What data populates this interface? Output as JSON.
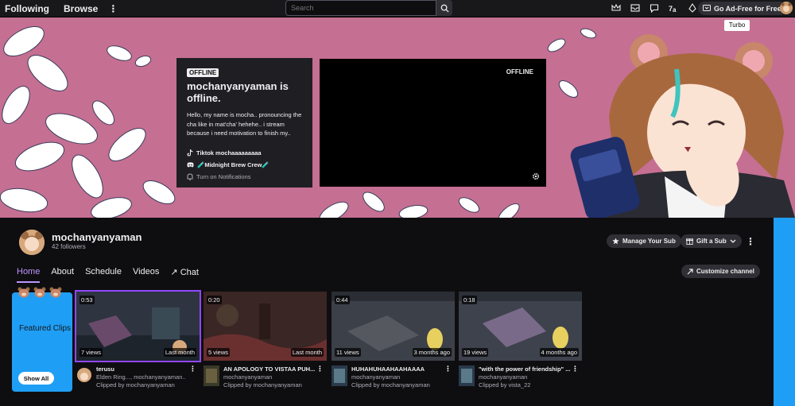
{
  "nav": {
    "following": "Following",
    "browse": "Browse",
    "more": "⋮",
    "search_placeholder": "Search",
    "ad_free": "Go Ad-Free for Free",
    "tooltip": "Turbo"
  },
  "card": {
    "offline_tag": "OFFLINE",
    "title": "mochanyanyaman is offline.",
    "description": "Hello, my name is mocha.. pronouncing the cha like in mat'cha' hehehe.. i stream because i need motivation to finish my..",
    "tiktok": "Tiktok mochaaaaaaaaa",
    "discord": "🧪Midnight Brew Crew🧪",
    "notifications": "Turn on Notifications"
  },
  "player": {
    "offline": "OFFLINE"
  },
  "channel": {
    "name": "mochanyanyaman",
    "followers": "42 followers",
    "manage_sub": "Manage Your Sub",
    "gift_sub": "Gift a Sub",
    "customize": "Customize channel",
    "more": "⋮",
    "tabs": [
      "Home",
      "About",
      "Schedule",
      "Videos",
      "Chat"
    ],
    "chat_arrow": "↗"
  },
  "featured": {
    "title": "Featured Clips",
    "show_all": "Show All"
  },
  "clips": [
    {
      "duration": "0:53",
      "views": "7 views",
      "age": "Last month",
      "title": "terusu",
      "line2": "Elden Ring..., mochanyanyaman..",
      "line3": "Clipped by mochanyanyaman",
      "thumb_color": "#3a3f4a"
    },
    {
      "duration": "0:20",
      "views": "5 views",
      "age": "Last month",
      "title": "AN APOLOGY TO VISTAA PUH...",
      "line2": "mochanyanyaman",
      "line3": "Clipped by mochanyanyaman",
      "thumb_color": "#4a2a2a"
    },
    {
      "duration": "0:44",
      "views": "11 views",
      "age": "3 months ago",
      "title": "HUHAHUHAAHAAHAAAA",
      "line2": "mochanyanyaman",
      "line3": "Clipped by mochanyanyaman",
      "thumb_color": "#3c4048"
    },
    {
      "duration": "0:18",
      "views": "19 views",
      "age": "4 months ago",
      "title": "\"with the power of friendship\" ...",
      "line2": "mochanyanyaman",
      "line3": "Clipped by vista_22",
      "thumb_color": "#3e424c"
    }
  ],
  "colors": {
    "accent": "#bf94ff",
    "banner": "#c56f92",
    "featured": "#1f9ef5"
  }
}
